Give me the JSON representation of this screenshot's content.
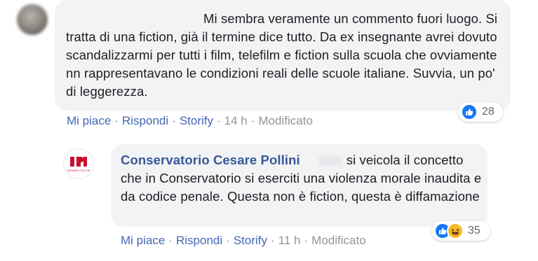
{
  "comment1": {
    "text_line1": "Mi sembra veramente un commento fuori",
    "text_rest": "luogo. Si tratta di una fiction, già il termine dice tutto. Da ex insegnante avrei dovuto scandalizzarmi per tutti i film, telefilm e fiction sulla scuola che ovviamente nn rappresentavano le condizioni reali delle scuole italiane. Suvvia, un po' di leggerezza.",
    "actions": {
      "like": "Mi piace",
      "reply": "Rispondi",
      "storify": "Storify",
      "time": "14 h",
      "edited": "Modificato",
      "separator": "·"
    },
    "reactions": {
      "count": "28",
      "icons": [
        "like-icon"
      ]
    }
  },
  "comment2": {
    "author": "Conservatorio Cesare Pollini",
    "text_start": "si",
    "text_rest": "veicola il concetto che in Conservatorio si eserciti una violenza morale inaudita e da codice penale. Questa non è fiction, questa è diffamazione",
    "actions": {
      "like": "Mi piace",
      "reply": "Rispondi",
      "storify": "Storify",
      "time": "11 h",
      "edited": "Modificato",
      "separator": "·"
    },
    "reactions": {
      "count": "35",
      "icons": [
        "like-icon",
        "haha-icon"
      ]
    },
    "logo_text": "CESARE POLLINI"
  },
  "colors": {
    "link": "#4267b2",
    "author": "#385898",
    "bubble": "#f2f3f5",
    "meta": "#90949c",
    "like": "#1877f2",
    "haha": "#f7b928"
  }
}
